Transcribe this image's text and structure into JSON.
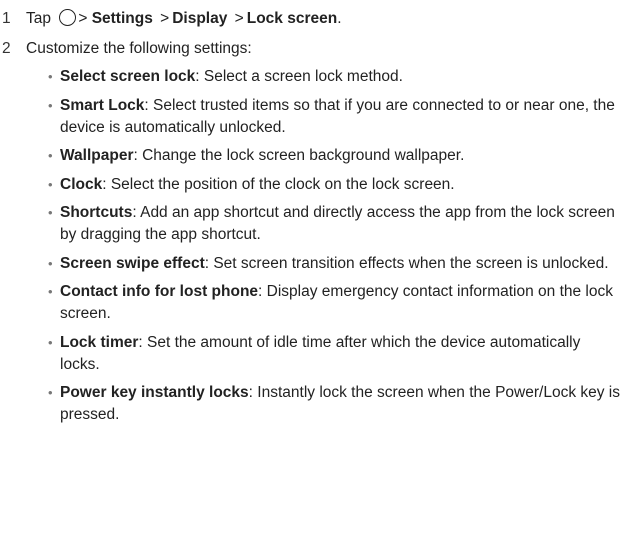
{
  "steps": [
    {
      "number": "1",
      "prefix": "Tap",
      "path": [
        "Settings",
        "Display",
        "Lock screen"
      ],
      "separator": ">",
      "end": ".",
      "icon": "home-circle-icon"
    },
    {
      "number": "2",
      "text": "Customize the following settings:"
    }
  ],
  "settings": [
    {
      "term": "Select screen lock",
      "desc": ": Select a screen lock method."
    },
    {
      "term": "Smart Lock",
      "desc": ": Select trusted items so that if you are connected to or near one, the device is automatically unlocked."
    },
    {
      "term": "Wallpaper",
      "desc": ": Change the lock screen background wallpaper."
    },
    {
      "term": "Clock",
      "desc": ": Select the position of the clock on the lock screen."
    },
    {
      "term": "Shortcuts",
      "desc": ": Add an app shortcut and directly access the app from the lock screen by dragging the app shortcut."
    },
    {
      "term": "Screen swipe effect",
      "desc": ": Set screen transition effects when the screen is unlocked."
    },
    {
      "term": "Contact info for lost phone",
      "desc": ": Display emergency contact information on the lock screen."
    },
    {
      "term": "Lock timer",
      "desc": ": Set the amount of idle time after which the device automatically locks."
    },
    {
      "term": "Power key instantly locks",
      "desc": ": Instantly lock the screen when the Power/Lock key is pressed."
    }
  ],
  "bullet": "•"
}
